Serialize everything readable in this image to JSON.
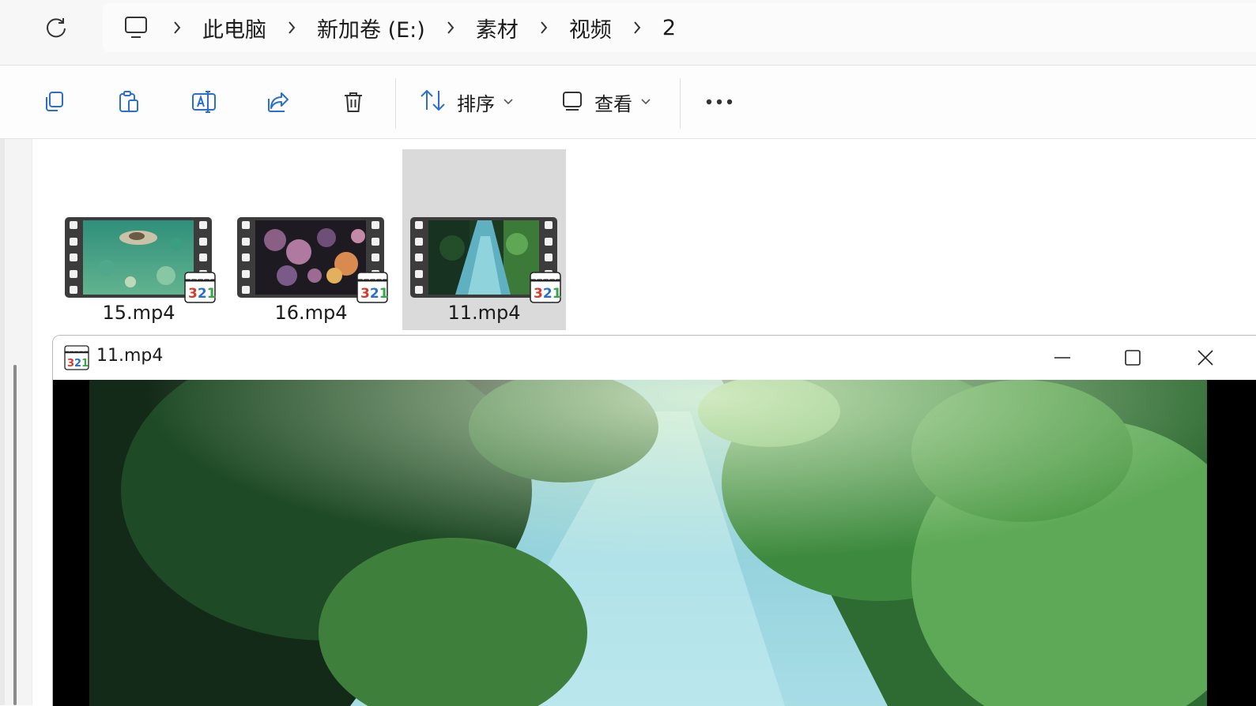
{
  "address_bar": {
    "breadcrumbs": [
      "此电脑",
      "新加卷 (E:)",
      "素材",
      "视频",
      "2"
    ]
  },
  "toolbar": {
    "sort_label": "排序",
    "view_label": "查看"
  },
  "files": [
    {
      "name": "15.mp4",
      "selected": false
    },
    {
      "name": "16.mp4",
      "selected": false
    },
    {
      "name": "11.mp4",
      "selected": true
    }
  ],
  "player": {
    "title": "11.mp4",
    "badge_text": "321"
  },
  "colors": {
    "selection": "#dadada",
    "badge_red": "#d83a2c",
    "badge_blue": "#2a6fd0",
    "badge_green": "#3aa64a"
  }
}
